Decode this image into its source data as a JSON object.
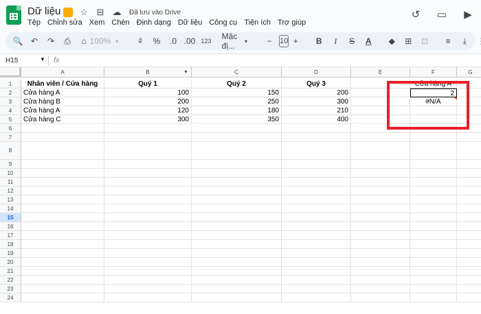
{
  "app": {
    "title": "Dữ liệu",
    "saved_status": "Đã lưu vào Drive",
    "menus": [
      "Tệp",
      "Chỉnh sửa",
      "Xem",
      "Chèn",
      "Định dạng",
      "Dữ liệu",
      "Công cụ",
      "Tiện ích",
      "Trợ giúp"
    ]
  },
  "toolbar": {
    "zoom": "100%",
    "currency": "₫",
    "percent": "%",
    "dec_decrease": ".0",
    "dec_increase": ".00",
    "number_format": "123",
    "font": "Mặc đị...",
    "font_size": "10",
    "bold": "B",
    "italic": "I",
    "strike": "S",
    "text_color": "A"
  },
  "formula_bar": {
    "name_box": "H15",
    "fx_label": "fx",
    "formula": ""
  },
  "sheet": {
    "columns": [
      "A",
      "B",
      "C",
      "D",
      "E",
      "F",
      "G"
    ],
    "rows": [
      "1",
      "2",
      "3",
      "4",
      "5",
      "6",
      "7",
      "8",
      "9",
      "10",
      "11",
      "12",
      "13",
      "14",
      "15",
      "16",
      "17",
      "18",
      "19",
      "20",
      "21",
      "22",
      "23",
      "24"
    ],
    "active_row": "15",
    "header": [
      "Nhân viên / Cửa hàng",
      "Quý 1",
      "Quý 2",
      "Quý 3"
    ],
    "data": [
      [
        "Cửa hàng A",
        "100",
        "150",
        "200"
      ],
      [
        "Cửa hàng B",
        "200",
        "250",
        "300"
      ],
      [
        "Cửa hàng A",
        "120",
        "180",
        "210"
      ],
      [
        "Cửa hàng C",
        "300",
        "350",
        "400"
      ]
    ],
    "f_column": {
      "f1": "Cửa hàng A",
      "f2": "2",
      "f3": "#N/A"
    }
  },
  "colors": {
    "highlight": "#e8202a",
    "brand": "#0f9d58"
  }
}
